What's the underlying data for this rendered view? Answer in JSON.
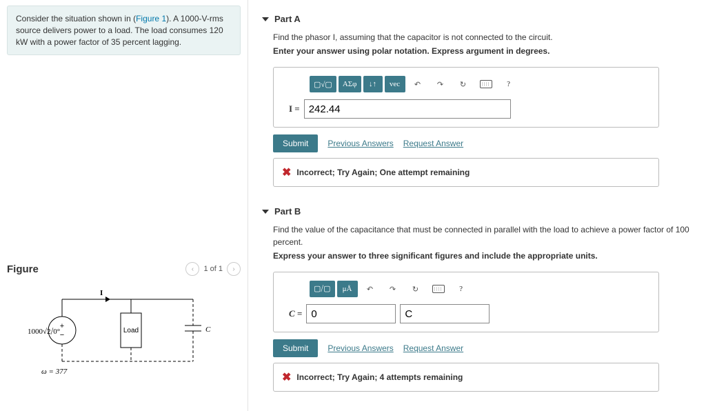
{
  "problem": {
    "text_pre": "Consider the situation shown in (",
    "fig_link": "Figure 1",
    "text_post": "). A 1000-V-rms source delivers power to a load. The load consumes 120 kW with a power factor of 35 percent lagging."
  },
  "figure": {
    "title": "Figure",
    "counter": "1 of 1",
    "circuit": {
      "source": "1000√2⧸0°",
      "omega": "ω = 377",
      "load": "Load",
      "cap": "C",
      "current": "I"
    }
  },
  "partA": {
    "title": "Part A",
    "prompt": "Find the phasor I, assuming that the capacitor is not connected to the circuit.",
    "instruction": "Enter your answer using polar notation. Express argument in degrees.",
    "toolbar": {
      "templates": "▢√▢",
      "greek": "ΑΣφ",
      "arrows": "↓↑",
      "vec": "vec",
      "undo": "↶",
      "redo": "↷",
      "reset": "↻",
      "help": "?"
    },
    "eq_label": "I =",
    "value": "242.44",
    "submit": "Submit",
    "prev": "Previous Answers",
    "req": "Request Answer",
    "feedback": "Incorrect; Try Again; One attempt remaining"
  },
  "partB": {
    "title": "Part B",
    "prompt": "Find the value of the capacitance that must be connected in parallel with the load to achieve a power factor of 100 percent.",
    "instruction": "Express your answer to three significant figures and include the appropriate units.",
    "toolbar": {
      "templates": "▢⧸▢",
      "units": "μÅ",
      "undo": "↶",
      "redo": "↷",
      "reset": "↻",
      "help": "?"
    },
    "eq_label": "C =",
    "value": "0",
    "unit": "C",
    "submit": "Submit",
    "prev": "Previous Answers",
    "req": "Request Answer",
    "feedback": "Incorrect; Try Again; 4 attempts remaining"
  }
}
